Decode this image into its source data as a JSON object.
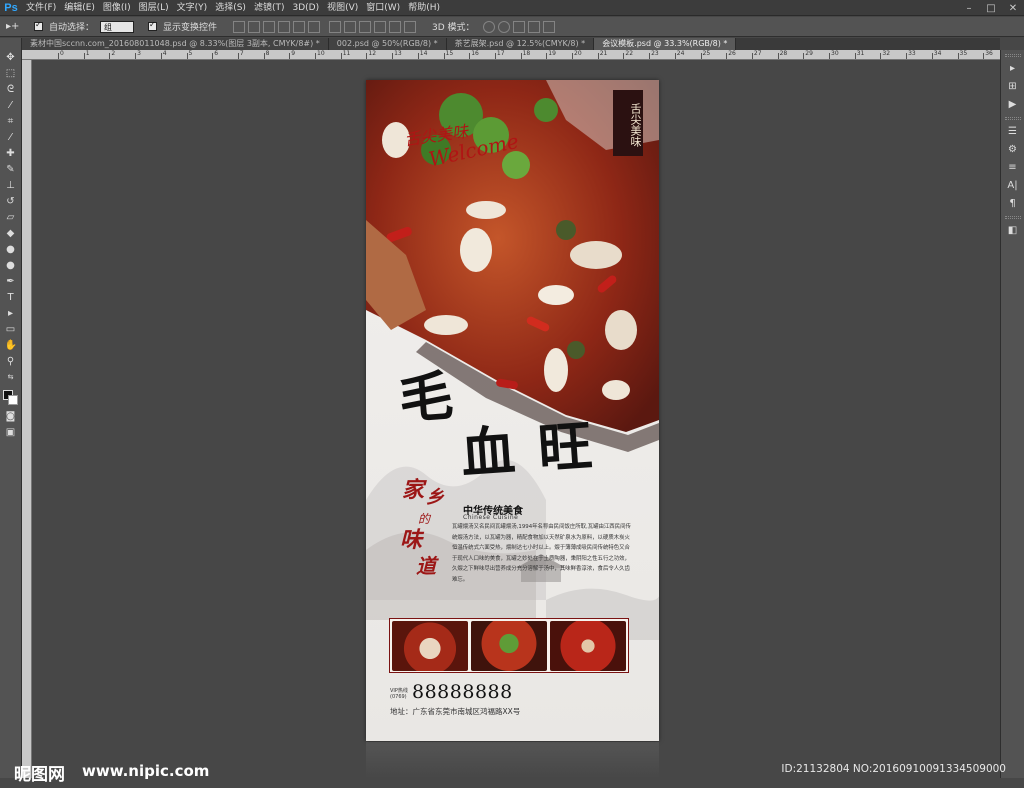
{
  "app": {
    "logo": "Ps"
  },
  "menu": [
    "文件(F)",
    "编辑(E)",
    "图像(I)",
    "图层(L)",
    "文字(Y)",
    "选择(S)",
    "滤镜(T)",
    "3D(D)",
    "视图(V)",
    "窗口(W)",
    "帮助(H)"
  ],
  "window_controls": {
    "min": "–",
    "max": "□",
    "close": "✕"
  },
  "options": {
    "tool_glyph": "▸+",
    "auto_select_label": "自动选择：",
    "auto_select_value": "组",
    "show_transform_label": "显示变换控件",
    "mode_3d_label": "3D 模式："
  },
  "tabs": [
    {
      "label": "素材中国sccnn.com_2016080110​48.psd @ 8.33%(图层 3副本, CMYK/8#) *",
      "active": false
    },
    {
      "label": "002.psd @ 50%(RGB/8) *",
      "active": false
    },
    {
      "label": "茶艺展架.psd @ 12.5%(CMYK/8) *",
      "active": false
    },
    {
      "label": "会议模板.psd @ 33.3%(RGB/8) *",
      "active": true
    }
  ],
  "ruler_labels": [
    "0",
    "1",
    "2",
    "3",
    "4",
    "5",
    "6",
    "7",
    "8",
    "9",
    "10",
    "11",
    "12",
    "13",
    "14",
    "15",
    "16",
    "17",
    "18",
    "19",
    "20",
    "21",
    "22",
    "23",
    "24",
    "25",
    "26",
    "27",
    "28",
    "29",
    "30",
    "31",
    "32",
    "33",
    "34",
    "35",
    "36",
    "37"
  ],
  "poster": {
    "seal_text": "舌尖美味",
    "script_zh": "舌尖美味",
    "script_en": "Welcome",
    "title_chars": [
      "毛",
      "血",
      "旺"
    ],
    "jiaxiang": [
      "家",
      "乡"
    ],
    "de": "的",
    "weidao": [
      "味",
      "道"
    ],
    "heading_zh": "中华传统美食",
    "heading_en": "Chinese Cuisine",
    "body": "瓦罐煨汤又名民间瓦罐煨汤,1994年名称由民间饭庄所取,瓦罐由江西民间传统煨汤方法，以瓦罐为器，精配食物加以天然矿泉水为原料，以硬质木炭火恒温传统式六面受热，煨制达七小时以上。煨于薄薄成吸民间传统特色又合于现代人口味的美食，瓦罐之妙处在于土质陶器，秉阴阳之性五行之功效，久煨之下鲜味尽出营养成分充分溶解于汤中，其味鲜香淳浓，食后令人久齿难忘。",
    "vip_label_1": "VIP热线",
    "vip_label_2": "(0769)",
    "phone": "88888888",
    "address": "地址：广东省东莞市南城区鸿福路XX号"
  },
  "watermark": {
    "site": "昵图网",
    "url": "www.nipic.com",
    "id": "ID:21132804 NO:20160910091334509000"
  },
  "colors": {
    "ps_blue": "#31a8ff",
    "accent_red": "#9c1616",
    "seal_bg": "#2b1111"
  }
}
